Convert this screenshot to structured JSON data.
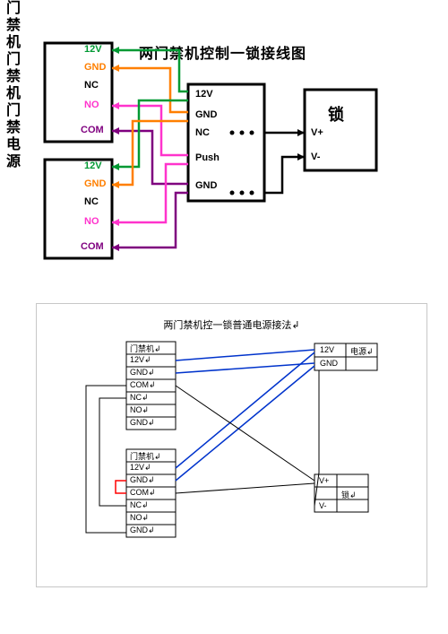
{
  "diagram1": {
    "title": "两门禁机控制一锁接线图",
    "controllers": [
      {
        "label": "门禁机",
        "pins": [
          "12V",
          "GND",
          "NC",
          "NO",
          "COM"
        ]
      },
      {
        "label": "门禁机",
        "pins": [
          "12V",
          "GND",
          "NC",
          "NO",
          "COM"
        ]
      }
    ],
    "power": {
      "label": "门禁电源",
      "pins": [
        "12V",
        "GND",
        "NC",
        "Push",
        "GND"
      ]
    },
    "lock": {
      "label": "锁",
      "pins": [
        "V+",
        "V-"
      ]
    },
    "wire_colors": {
      "12V": "#009933",
      "GND": "#ff7f00",
      "NC": "#000000",
      "NO": "#ff33cc",
      "COM": "#7f007f"
    }
  },
  "diagram2": {
    "title": "两门禁机控一锁普通电源接法↲",
    "controllers": [
      {
        "label": "门禁机↲",
        "pins": [
          "12V↲",
          "GND↲",
          "COM↲",
          "NC↲",
          "NO↲",
          "GND↲"
        ]
      },
      {
        "label": "门禁机↲",
        "pins": [
          "12V↲",
          "GND↲",
          "COM↲",
          "NC↲",
          "NO↲",
          "GND↲"
        ]
      }
    ],
    "power": {
      "lines": [
        "12V",
        "GND"
      ],
      "label": "电源↲"
    },
    "lock": {
      "lines": [
        "V+",
        "V-"
      ],
      "label": "锁↲"
    }
  }
}
